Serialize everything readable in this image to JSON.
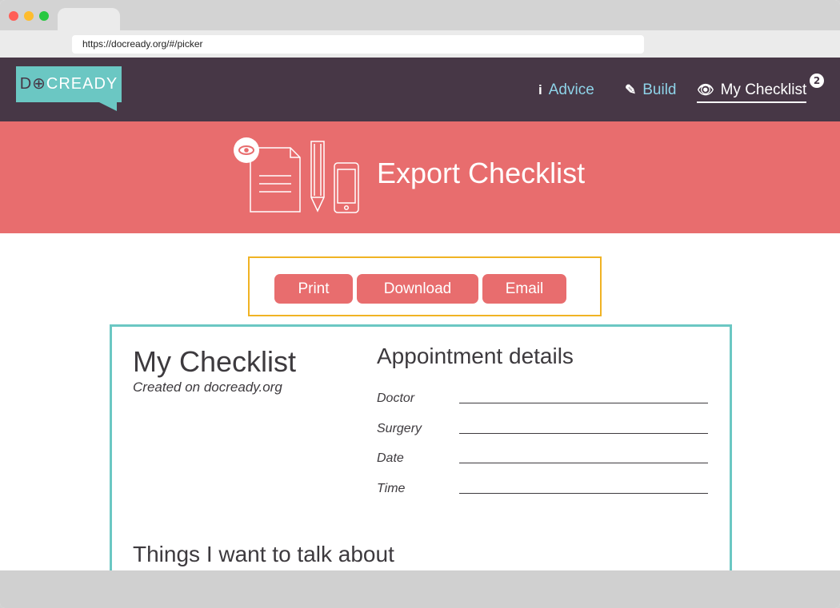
{
  "browser": {
    "url": "https://docready.org/#/picker",
    "colors": {
      "close": "#ff5f57",
      "minimize": "#febc2e",
      "maximize": "#28c840"
    }
  },
  "nav": {
    "logo_text_1": "D",
    "logo_text_2": "⊕",
    "logo_text_3": "CREADY",
    "items": [
      {
        "label": "Advice",
        "icon": "info-icon"
      },
      {
        "label": "Build",
        "icon": "pencil-icon"
      },
      {
        "label": "My Checklist",
        "icon": "eye-icon"
      }
    ],
    "badge_count": "2"
  },
  "hero": {
    "title": "Export Checklist"
  },
  "actions": {
    "print": "Print",
    "download": "Download",
    "email": "Email"
  },
  "checklist": {
    "title": "My Checklist",
    "subtitle": "Created on docready.org",
    "appointment_heading": "Appointment details",
    "fields": [
      "Doctor",
      "Surgery",
      "Date",
      "Time"
    ],
    "things_heading": "Things I want to talk about"
  },
  "colors": {
    "navbar": "#473746",
    "hero": "#e86d6e",
    "accent": "#6bc7c3",
    "highlight": "#f0b324",
    "link": "#8ed3e8"
  }
}
